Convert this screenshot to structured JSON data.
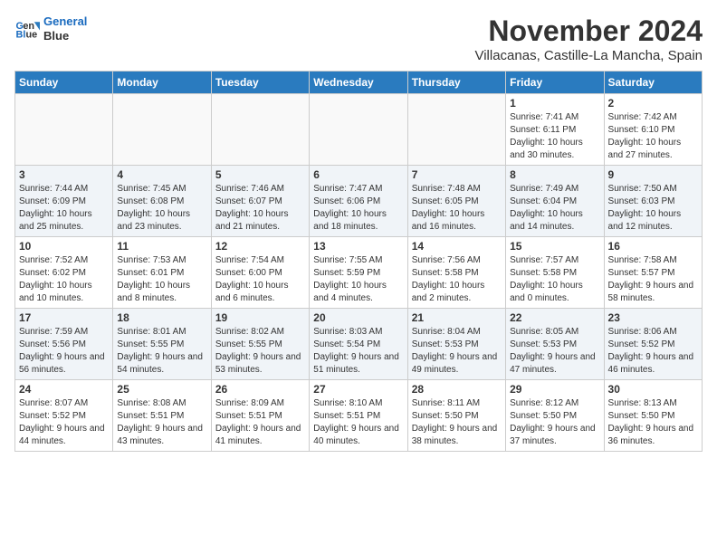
{
  "logo": {
    "line1": "General",
    "line2": "Blue"
  },
  "title": "November 2024",
  "location": "Villacanas, Castille-La Mancha, Spain",
  "days_of_week": [
    "Sunday",
    "Monday",
    "Tuesday",
    "Wednesday",
    "Thursday",
    "Friday",
    "Saturday"
  ],
  "weeks": [
    [
      {
        "day": "",
        "info": ""
      },
      {
        "day": "",
        "info": ""
      },
      {
        "day": "",
        "info": ""
      },
      {
        "day": "",
        "info": ""
      },
      {
        "day": "",
        "info": ""
      },
      {
        "day": "1",
        "info": "Sunrise: 7:41 AM\nSunset: 6:11 PM\nDaylight: 10 hours and 30 minutes."
      },
      {
        "day": "2",
        "info": "Sunrise: 7:42 AM\nSunset: 6:10 PM\nDaylight: 10 hours and 27 minutes."
      }
    ],
    [
      {
        "day": "3",
        "info": "Sunrise: 7:44 AM\nSunset: 6:09 PM\nDaylight: 10 hours and 25 minutes."
      },
      {
        "day": "4",
        "info": "Sunrise: 7:45 AM\nSunset: 6:08 PM\nDaylight: 10 hours and 23 minutes."
      },
      {
        "day": "5",
        "info": "Sunrise: 7:46 AM\nSunset: 6:07 PM\nDaylight: 10 hours and 21 minutes."
      },
      {
        "day": "6",
        "info": "Sunrise: 7:47 AM\nSunset: 6:06 PM\nDaylight: 10 hours and 18 minutes."
      },
      {
        "day": "7",
        "info": "Sunrise: 7:48 AM\nSunset: 6:05 PM\nDaylight: 10 hours and 16 minutes."
      },
      {
        "day": "8",
        "info": "Sunrise: 7:49 AM\nSunset: 6:04 PM\nDaylight: 10 hours and 14 minutes."
      },
      {
        "day": "9",
        "info": "Sunrise: 7:50 AM\nSunset: 6:03 PM\nDaylight: 10 hours and 12 minutes."
      }
    ],
    [
      {
        "day": "10",
        "info": "Sunrise: 7:52 AM\nSunset: 6:02 PM\nDaylight: 10 hours and 10 minutes."
      },
      {
        "day": "11",
        "info": "Sunrise: 7:53 AM\nSunset: 6:01 PM\nDaylight: 10 hours and 8 minutes."
      },
      {
        "day": "12",
        "info": "Sunrise: 7:54 AM\nSunset: 6:00 PM\nDaylight: 10 hours and 6 minutes."
      },
      {
        "day": "13",
        "info": "Sunrise: 7:55 AM\nSunset: 5:59 PM\nDaylight: 10 hours and 4 minutes."
      },
      {
        "day": "14",
        "info": "Sunrise: 7:56 AM\nSunset: 5:58 PM\nDaylight: 10 hours and 2 minutes."
      },
      {
        "day": "15",
        "info": "Sunrise: 7:57 AM\nSunset: 5:58 PM\nDaylight: 10 hours and 0 minutes."
      },
      {
        "day": "16",
        "info": "Sunrise: 7:58 AM\nSunset: 5:57 PM\nDaylight: 9 hours and 58 minutes."
      }
    ],
    [
      {
        "day": "17",
        "info": "Sunrise: 7:59 AM\nSunset: 5:56 PM\nDaylight: 9 hours and 56 minutes."
      },
      {
        "day": "18",
        "info": "Sunrise: 8:01 AM\nSunset: 5:55 PM\nDaylight: 9 hours and 54 minutes."
      },
      {
        "day": "19",
        "info": "Sunrise: 8:02 AM\nSunset: 5:55 PM\nDaylight: 9 hours and 53 minutes."
      },
      {
        "day": "20",
        "info": "Sunrise: 8:03 AM\nSunset: 5:54 PM\nDaylight: 9 hours and 51 minutes."
      },
      {
        "day": "21",
        "info": "Sunrise: 8:04 AM\nSunset: 5:53 PM\nDaylight: 9 hours and 49 minutes."
      },
      {
        "day": "22",
        "info": "Sunrise: 8:05 AM\nSunset: 5:53 PM\nDaylight: 9 hours and 47 minutes."
      },
      {
        "day": "23",
        "info": "Sunrise: 8:06 AM\nSunset: 5:52 PM\nDaylight: 9 hours and 46 minutes."
      }
    ],
    [
      {
        "day": "24",
        "info": "Sunrise: 8:07 AM\nSunset: 5:52 PM\nDaylight: 9 hours and 44 minutes."
      },
      {
        "day": "25",
        "info": "Sunrise: 8:08 AM\nSunset: 5:51 PM\nDaylight: 9 hours and 43 minutes."
      },
      {
        "day": "26",
        "info": "Sunrise: 8:09 AM\nSunset: 5:51 PM\nDaylight: 9 hours and 41 minutes."
      },
      {
        "day": "27",
        "info": "Sunrise: 8:10 AM\nSunset: 5:51 PM\nDaylight: 9 hours and 40 minutes."
      },
      {
        "day": "28",
        "info": "Sunrise: 8:11 AM\nSunset: 5:50 PM\nDaylight: 9 hours and 38 minutes."
      },
      {
        "day": "29",
        "info": "Sunrise: 8:12 AM\nSunset: 5:50 PM\nDaylight: 9 hours and 37 minutes."
      },
      {
        "day": "30",
        "info": "Sunrise: 8:13 AM\nSunset: 5:50 PM\nDaylight: 9 hours and 36 minutes."
      }
    ]
  ]
}
